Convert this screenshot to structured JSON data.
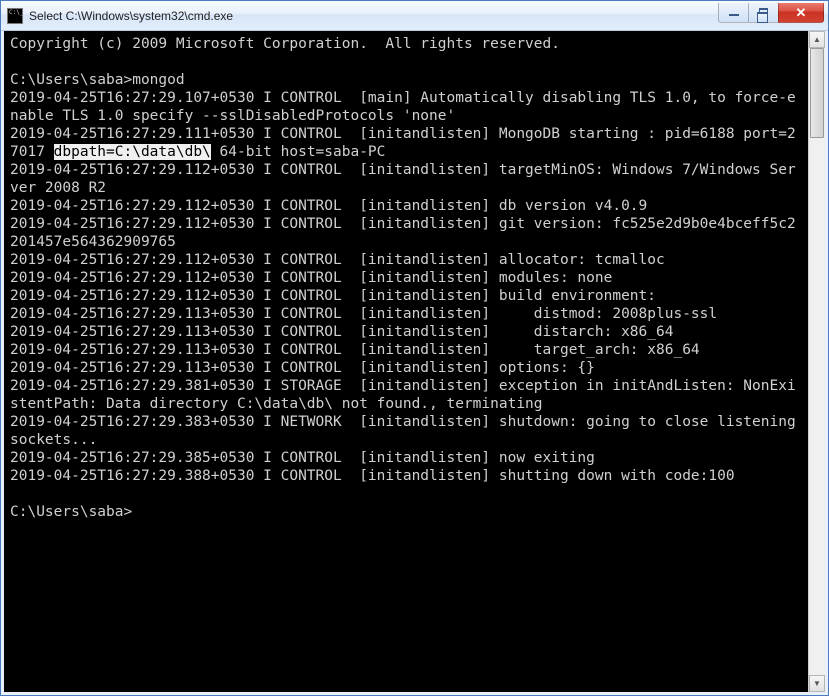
{
  "window": {
    "title": "Select C:\\Windows\\system32\\cmd.exe"
  },
  "terminal": {
    "copyright": "Copyright (c) 2009 Microsoft Corporation.  All rights reserved.",
    "blank1": "",
    "prompt1": "C:\\Users\\saba>mongod",
    "line_tls": "2019-04-25T16:27:29.107+0530 I CONTROL  [main] Automatically disabling TLS 1.0, to force-enable TLS 1.0 specify --sslDisabledProtocols 'none'",
    "line_start_pre": "2019-04-25T16:27:29.111+0530 I CONTROL  [initandlisten] MongoDB starting : pid=6188 port=27017 ",
    "line_start_hl": "dbpath=C:\\data\\db\\",
    "line_start_post": " 64-bit host=saba-PC",
    "line_targetos": "2019-04-25T16:27:29.112+0530 I CONTROL  [initandlisten] targetMinOS: Windows 7/Windows Server 2008 R2",
    "line_dbver": "2019-04-25T16:27:29.112+0530 I CONTROL  [initandlisten] db version v4.0.9",
    "line_gitver": "2019-04-25T16:27:29.112+0530 I CONTROL  [initandlisten] git version: fc525e2d9b0e4bceff5c2201457e564362909765",
    "line_alloc": "2019-04-25T16:27:29.112+0530 I CONTROL  [initandlisten] allocator: tcmalloc",
    "line_modules": "2019-04-25T16:27:29.112+0530 I CONTROL  [initandlisten] modules: none",
    "line_buildenv": "2019-04-25T16:27:29.112+0530 I CONTROL  [initandlisten] build environment:",
    "line_distmod": "2019-04-25T16:27:29.113+0530 I CONTROL  [initandlisten]     distmod: 2008plus-ssl",
    "line_distarch": "2019-04-25T16:27:29.113+0530 I CONTROL  [initandlisten]     distarch: x86_64",
    "line_targetarch": "2019-04-25T16:27:29.113+0530 I CONTROL  [initandlisten]     target_arch: x86_64",
    "line_options": "2019-04-25T16:27:29.113+0530 I CONTROL  [initandlisten] options: {}",
    "line_exception": "2019-04-25T16:27:29.381+0530 I STORAGE  [initandlisten] exception in initAndListen: NonExistentPath: Data directory C:\\data\\db\\ not found., terminating",
    "line_shutdown": "2019-04-25T16:27:29.383+0530 I NETWORK  [initandlisten] shutdown: going to close listening sockets...",
    "line_exit": "2019-04-25T16:27:29.385+0530 I CONTROL  [initandlisten] now exiting",
    "line_code": "2019-04-25T16:27:29.388+0530 I CONTROL  [initandlisten] shutting down with code:100",
    "blank2": "",
    "prompt2": "C:\\Users\\saba>"
  }
}
